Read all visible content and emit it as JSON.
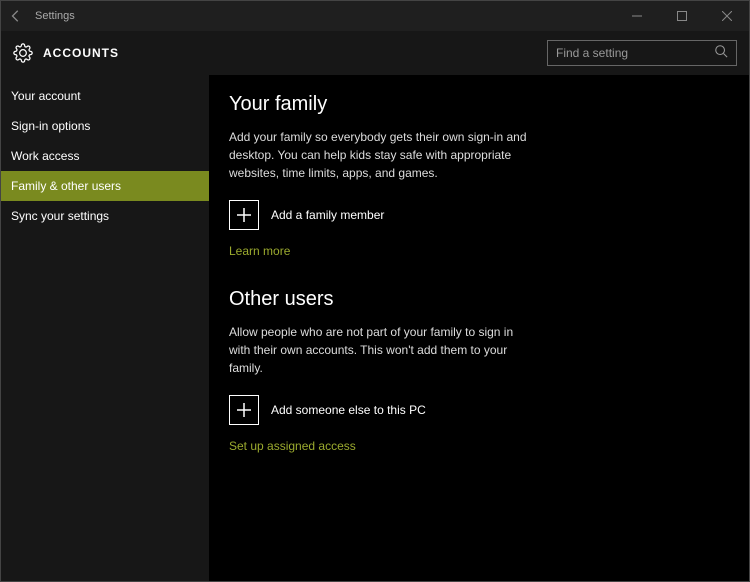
{
  "titlebar": {
    "title": "Settings"
  },
  "header": {
    "title": "ACCOUNTS",
    "search_placeholder": "Find a setting"
  },
  "sidebar": {
    "items": [
      {
        "label": "Your account",
        "active": false
      },
      {
        "label": "Sign-in options",
        "active": false
      },
      {
        "label": "Work access",
        "active": false
      },
      {
        "label": "Family & other users",
        "active": true
      },
      {
        "label": "Sync your settings",
        "active": false
      }
    ]
  },
  "main": {
    "family": {
      "heading": "Your family",
      "description": "Add your family so everybody gets their own sign-in and desktop. You can help kids stay safe with appropriate websites, time limits, apps, and games.",
      "add_label": "Add a family member",
      "learn_more": "Learn more"
    },
    "other": {
      "heading": "Other users",
      "description": "Allow people who are not part of your family to sign in with their own accounts. This won't add them to your family.",
      "add_label": "Add someone else to this PC",
      "assigned_link": "Set up assigned access"
    }
  }
}
